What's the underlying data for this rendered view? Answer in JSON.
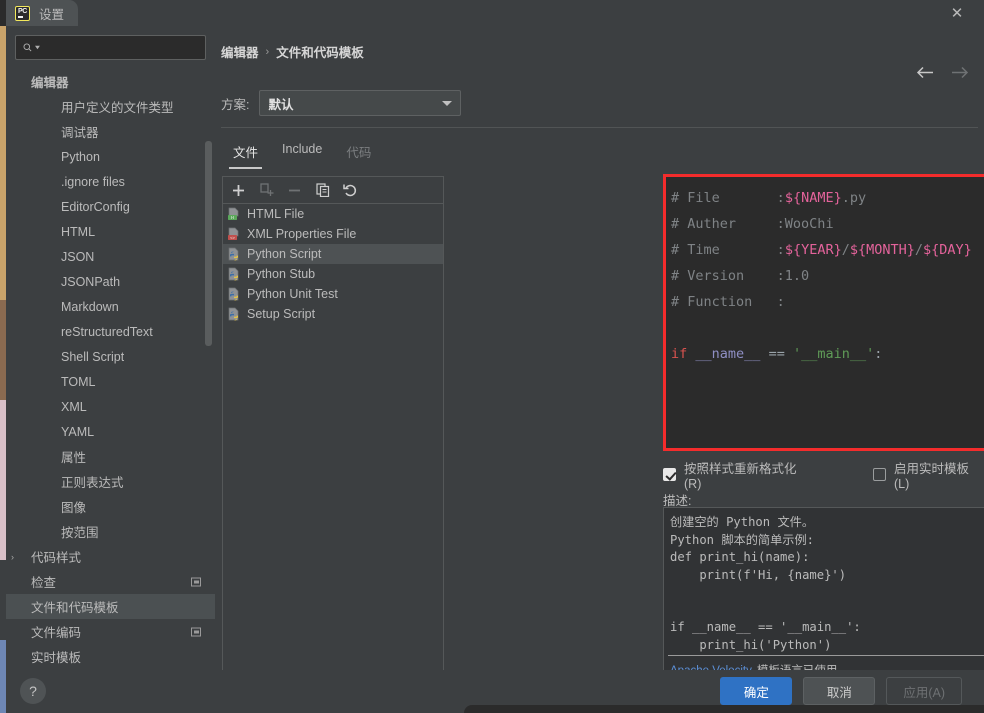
{
  "window": {
    "logo": "pycharm-logo",
    "title": "设置",
    "close": "✕"
  },
  "sidebar": {
    "search_placeholder": "",
    "search_value": "",
    "items": [
      {
        "label": "编辑器",
        "indent": 0,
        "bold": true,
        "selected": false,
        "arrow": "",
        "badge": false
      },
      {
        "label": "用户定义的文件类型",
        "indent": 1,
        "bold": false,
        "selected": false,
        "arrow": "",
        "badge": false
      },
      {
        "label": "调试器",
        "indent": 1,
        "bold": false,
        "selected": false,
        "arrow": "",
        "badge": false
      },
      {
        "label": "Python",
        "indent": 1,
        "bold": false,
        "selected": false,
        "arrow": "",
        "badge": false
      },
      {
        "label": ".ignore files",
        "indent": 1,
        "bold": false,
        "selected": false,
        "arrow": "",
        "badge": false
      },
      {
        "label": "EditorConfig",
        "indent": 1,
        "bold": false,
        "selected": false,
        "arrow": "",
        "badge": false
      },
      {
        "label": "HTML",
        "indent": 1,
        "bold": false,
        "selected": false,
        "arrow": "",
        "badge": false
      },
      {
        "label": "JSON",
        "indent": 1,
        "bold": false,
        "selected": false,
        "arrow": "",
        "badge": false
      },
      {
        "label": "JSONPath",
        "indent": 1,
        "bold": false,
        "selected": false,
        "arrow": "",
        "badge": false
      },
      {
        "label": "Markdown",
        "indent": 1,
        "bold": false,
        "selected": false,
        "arrow": "",
        "badge": false
      },
      {
        "label": "reStructuredText",
        "indent": 1,
        "bold": false,
        "selected": false,
        "arrow": "",
        "badge": false
      },
      {
        "label": "Shell Script",
        "indent": 1,
        "bold": false,
        "selected": false,
        "arrow": "",
        "badge": false
      },
      {
        "label": "TOML",
        "indent": 1,
        "bold": false,
        "selected": false,
        "arrow": "",
        "badge": false
      },
      {
        "label": "XML",
        "indent": 1,
        "bold": false,
        "selected": false,
        "arrow": "",
        "badge": false
      },
      {
        "label": "YAML",
        "indent": 1,
        "bold": false,
        "selected": false,
        "arrow": "",
        "badge": false
      },
      {
        "label": "属性",
        "indent": 1,
        "bold": false,
        "selected": false,
        "arrow": "",
        "badge": false
      },
      {
        "label": "正则表达式",
        "indent": 1,
        "bold": false,
        "selected": false,
        "arrow": "",
        "badge": false
      },
      {
        "label": "图像",
        "indent": 1,
        "bold": false,
        "selected": false,
        "arrow": "",
        "badge": false
      },
      {
        "label": "按范围",
        "indent": 1,
        "bold": false,
        "selected": false,
        "arrow": "",
        "badge": false
      },
      {
        "label": "代码样式",
        "indent": 0,
        "bold": false,
        "selected": false,
        "arrow": "›",
        "badge": false
      },
      {
        "label": "检查",
        "indent": 0,
        "bold": false,
        "selected": false,
        "arrow": "",
        "badge": true
      },
      {
        "label": "文件和代码模板",
        "indent": 0,
        "bold": false,
        "selected": true,
        "arrow": "",
        "badge": false
      },
      {
        "label": "文件编码",
        "indent": 0,
        "bold": false,
        "selected": false,
        "arrow": "",
        "badge": true
      },
      {
        "label": "实时模板",
        "indent": 0,
        "bold": false,
        "selected": false,
        "arrow": "",
        "badge": false
      }
    ]
  },
  "breadcrumb": {
    "parent": "编辑器",
    "separator": "›",
    "current": "文件和代码模板"
  },
  "nav": {
    "back": "←",
    "forward": "→"
  },
  "scheme": {
    "label": "方案:",
    "value": "默认"
  },
  "tabs": [
    {
      "label": "文件",
      "state": "active"
    },
    {
      "label": "Include",
      "state": "normal"
    },
    {
      "label": "代码",
      "state": "dim"
    }
  ],
  "list_toolbar": [
    {
      "name": "add",
      "glyph": "+",
      "enabled": true
    },
    {
      "name": "add-child",
      "glyph": "",
      "enabled": false
    },
    {
      "name": "remove",
      "glyph": "−",
      "enabled": false
    },
    {
      "name": "copy",
      "glyph": "",
      "enabled": true
    },
    {
      "name": "reset",
      "glyph": "↺",
      "enabled": true
    }
  ],
  "templates": [
    {
      "label": "HTML File",
      "icon": "html-file-icon",
      "selected": false
    },
    {
      "label": "XML Properties File",
      "icon": "xml-file-icon",
      "selected": false
    },
    {
      "label": "Python Script",
      "icon": "python-file-icon",
      "selected": true
    },
    {
      "label": "Python Stub",
      "icon": "python-file-icon",
      "selected": false
    },
    {
      "label": "Python Unit Test",
      "icon": "python-file-icon",
      "selected": false
    },
    {
      "label": "Setup Script",
      "icon": "python-file-icon",
      "selected": false
    }
  ],
  "editor": {
    "lines": [
      [
        {
          "t": "# File       ",
          "c": "c-com"
        },
        {
          "t": ":",
          "c": "c-com"
        },
        {
          "t": "${NAME}",
          "c": "c-var"
        },
        {
          "t": ".py",
          "c": "c-com"
        }
      ],
      [
        {
          "t": "# Auther     ",
          "c": "c-com"
        },
        {
          "t": ":WooChi",
          "c": "c-com"
        }
      ],
      [
        {
          "t": "# Time       ",
          "c": "c-com"
        },
        {
          "t": ":",
          "c": "c-com"
        },
        {
          "t": "${YEAR}",
          "c": "c-var"
        },
        {
          "t": "/",
          "c": "c-com"
        },
        {
          "t": "${MONTH}",
          "c": "c-var"
        },
        {
          "t": "/",
          "c": "c-com"
        },
        {
          "t": "${DAY}",
          "c": "c-var"
        }
      ],
      [
        {
          "t": "# Version    ",
          "c": "c-com"
        },
        {
          "t": ":1.0",
          "c": "c-com"
        }
      ],
      [
        {
          "t": "# Function   ",
          "c": "c-com"
        },
        {
          "t": ":",
          "c": "c-com"
        }
      ],
      [
        {
          "t": "",
          "c": "c-plain"
        }
      ],
      [
        {
          "t": "if",
          "c": "c-kw"
        },
        {
          "t": " ",
          "c": "c-plain"
        },
        {
          "t": "__name__",
          "c": "c-ident"
        },
        {
          "t": " ",
          "c": "c-plain"
        },
        {
          "t": "==",
          "c": "c-op"
        },
        {
          "t": " ",
          "c": "c-plain"
        },
        {
          "t": "'__main__'",
          "c": "c-str"
        },
        {
          "t": ":",
          "c": "c-op"
        }
      ]
    ]
  },
  "options": [
    {
      "label": "按照样式重新格式化(R)",
      "checked": true
    },
    {
      "label": "启用实时模板 (L)",
      "checked": false
    }
  ],
  "description": {
    "label": "描述:",
    "body": "创建空的 Python 文件。\nPython 脚本的简单示例:\ndef print_hi(name):\n    print(f'Hi, {name}')\n\n\nif __name__ == '__main__':\n    print_hi('Python')",
    "footer_link": "Apache Velocity",
    "footer_text": "模板语言已使用"
  },
  "footer": {
    "help": "?",
    "buttons": [
      {
        "label": "确定",
        "style": "primary"
      },
      {
        "label": "取消",
        "style": "normal"
      },
      {
        "label": "应用(A)",
        "style": "disabled"
      }
    ]
  },
  "colors": {
    "accent": "#2f72c4",
    "annotation": "#f42c2c",
    "panel": "#3c3f41",
    "editor_bg": "#2b2b2b",
    "variable": "#e4639b",
    "keyword": "#d9534f",
    "string": "#5f9a57",
    "link": "#5c8fd6"
  }
}
